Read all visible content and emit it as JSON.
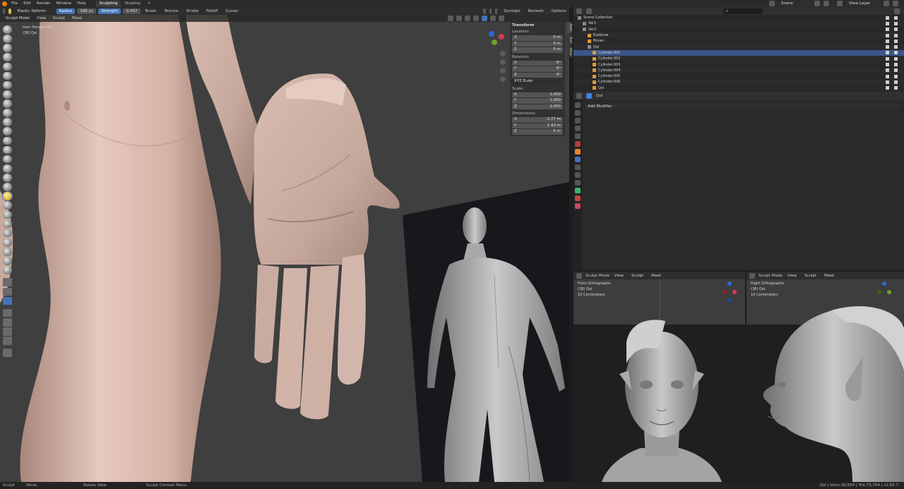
{
  "topbar": {
    "menus": [
      "File",
      "Edit",
      "Render",
      "Window",
      "Help"
    ],
    "workspaces": [
      "Sculpting",
      "Shading"
    ],
    "active_workspace": "Sculpting",
    "add_tab": "+",
    "scene": "Scene",
    "view_layer": "View Layer"
  },
  "tool_header": {
    "brush_name": "Elastic Deform",
    "radius_label": "Radius",
    "radius_value": "188 px",
    "strength_label": "Strength",
    "strength_value": "0.457",
    "menus": [
      "Brush",
      "Texture",
      "Stroke",
      "Falloff",
      "Cursor"
    ],
    "dyntopo": "Dyntopo",
    "remesh": "Remesh",
    "options": "Options"
  },
  "view_header": {
    "mode": "Sculpt Mode",
    "menus": [
      "View",
      "Sculpt",
      "Mask"
    ]
  },
  "viewport_overlay": {
    "line1": "User Perspective",
    "line2": "(38) Qol"
  },
  "npanel": {
    "transform": "Transform",
    "location_label": "Location:",
    "location": [
      {
        "axis": "X",
        "value": "0 m"
      },
      {
        "axis": "Y",
        "value": "0 m"
      },
      {
        "axis": "Z",
        "value": "0 m"
      }
    ],
    "rotation_label": "Rotation:",
    "rotation": [
      {
        "axis": "X",
        "value": "0°"
      },
      {
        "axis": "Y",
        "value": "0°"
      },
      {
        "axis": "Z",
        "value": "0°"
      }
    ],
    "rotation_mode": "XYZ Euler",
    "scale_label": "Scale:",
    "scale": [
      {
        "axis": "X",
        "value": "1.000"
      },
      {
        "axis": "Y",
        "value": "1.000"
      },
      {
        "axis": "Z",
        "value": "1.000"
      }
    ],
    "dimensions_label": "Dimensions:",
    "dimensions": [
      {
        "axis": "X",
        "value": "2.77 m"
      },
      {
        "axis": "Y",
        "value": "1.43 m"
      },
      {
        "axis": "Z",
        "value": "5 m"
      }
    ],
    "tabs": [
      "Item",
      "Tool",
      "View"
    ]
  },
  "outliner": {
    "rows": [
      {
        "name": "Scene Collection",
        "indent": 0,
        "type": "collection"
      },
      {
        "name": "Ver1",
        "indent": 1,
        "type": "collection"
      },
      {
        "name": "Ver2",
        "indent": 1,
        "type": "collection"
      },
      {
        "name": "Eyebrow",
        "indent": 2,
        "type": "mesh"
      },
      {
        "name": "Brows",
        "indent": 2,
        "type": "mesh"
      },
      {
        "name": "Qol",
        "indent": 2,
        "type": "collection"
      },
      {
        "name": "Cylinder.001",
        "indent": 3,
        "type": "mesh",
        "selected": true
      },
      {
        "name": "Cylinder.002",
        "indent": 3,
        "type": "mesh"
      },
      {
        "name": "Cylinder.003",
        "indent": 3,
        "type": "mesh"
      },
      {
        "name": "Cylinder.004",
        "indent": 3,
        "type": "mesh"
      },
      {
        "name": "Cylinder.005",
        "indent": 3,
        "type": "mesh"
      },
      {
        "name": "Cylinder.006",
        "indent": 3,
        "type": "mesh"
      },
      {
        "name": "Qol",
        "indent": 3,
        "type": "mesh"
      }
    ]
  },
  "properties": {
    "object_name": "Qol",
    "add_modifier": "Add Modifier"
  },
  "front_view": {
    "mode": "Sculpt Mode",
    "menus": [
      "View",
      "Sculpt",
      "Mask"
    ],
    "line1": "Front Orthographic",
    "line2": "(38) Qol",
    "line3": "10 Centimeters"
  },
  "right_view": {
    "mode": "Sculpt Mode",
    "menus": [
      "View",
      "Sculpt",
      "Mask"
    ],
    "line1": "Right Orthographic",
    "line2": "(38) Qol",
    "line3": "10 Centimeters"
  },
  "statusbar": {
    "items": [
      "Sculpt",
      "Move",
      "Rotate View",
      "Sculpt Context Menu"
    ],
    "stats": "Qol | Verts:36,854 | Tris:73,704 | v2.82.7"
  },
  "colors": {
    "accent_blue": "#4772b3",
    "skin": "#d9b8ac",
    "clay": "#b9b9b9"
  }
}
